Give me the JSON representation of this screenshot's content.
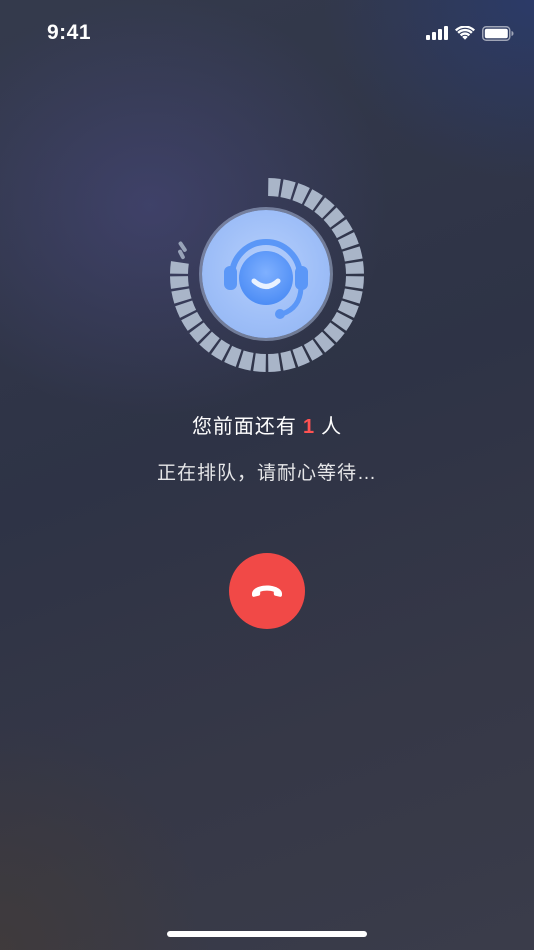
{
  "status_bar": {
    "time": "9:41",
    "icons": [
      "cellular-signal-icon",
      "wifi-icon",
      "battery-icon"
    ]
  },
  "queue": {
    "progress": 0.78,
    "avatar_icon": "customer-service-headset-icon",
    "line_prefix": "您前面还有",
    "count": "1",
    "line_suffix": "人",
    "status_text": "正在排队，请耐心等待…"
  },
  "hangup": {
    "icon": "phone-hangup-icon"
  },
  "colors": {
    "accent_red": "#f14947",
    "count_red": "#ff5252",
    "ring_filled": "#a9b5c8",
    "avatar_blue": "#9fbff8"
  }
}
